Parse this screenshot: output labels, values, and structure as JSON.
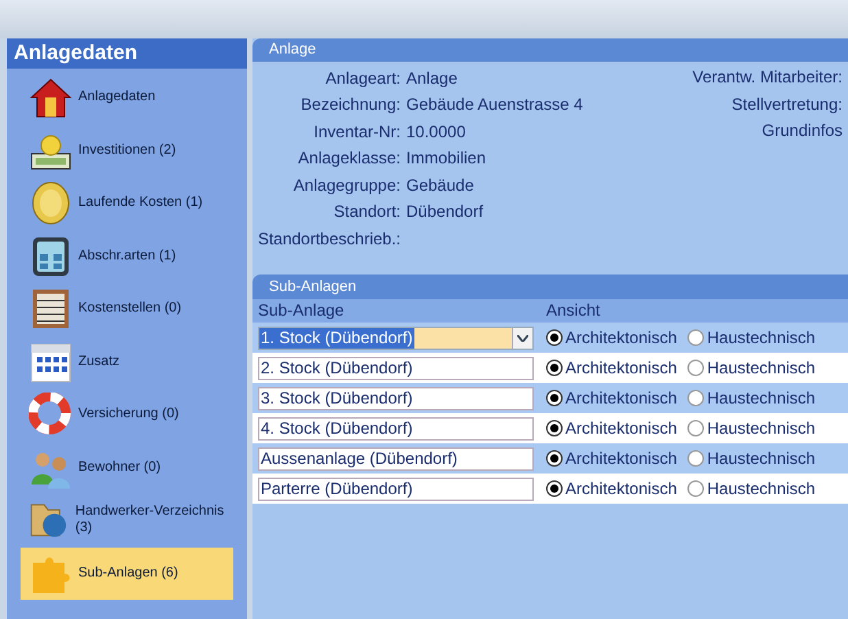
{
  "sidebar": {
    "title": "Anlagedaten",
    "items": [
      {
        "label": "Anlagedaten",
        "selected": false
      },
      {
        "label": "Investitionen (2)",
        "selected": false
      },
      {
        "label": "Laufende Kosten (1)",
        "selected": false
      },
      {
        "label": "Abschr.arten (1)",
        "selected": false
      },
      {
        "label": "Kostenstellen (0)",
        "selected": false
      },
      {
        "label": "Zusatz",
        "selected": false
      },
      {
        "label": "Versicherung (0)",
        "selected": false
      },
      {
        "label": "Bewohner (0)",
        "selected": false
      },
      {
        "label": "Handwerker-Verzeichnis (3)",
        "selected": false
      },
      {
        "label": "Sub-Anlagen (6)",
        "selected": true
      }
    ]
  },
  "anlage": {
    "title": "Anlage",
    "fields": [
      {
        "label": "Anlageart:",
        "value": "Anlage"
      },
      {
        "label": "Bezeichnung:",
        "value": "Gebäude Auenstrasse 4"
      },
      {
        "label": "Inventar-Nr:",
        "value": "10.0000"
      },
      {
        "label": "Anlageklasse:",
        "value": "Immobilien"
      },
      {
        "label": "Anlagegruppe:",
        "value": "Gebäude"
      },
      {
        "label": "Standort:",
        "value": "Dübendorf"
      },
      {
        "label": "Standortbeschrieb.:"
      }
    ],
    "right_labels": [
      "Verantw. Mitarbeiter:",
      "Stellvertretung:",
      "Grundinfos"
    ]
  },
  "sub_anlagen": {
    "title": "Sub-Anlagen",
    "columns": [
      "Sub-Anlage",
      "Ansicht"
    ],
    "rows": [
      {
        "kind": "combo",
        "value": "1. Stock (Dübendorf)",
        "options": [
          {
            "label": "Architektonisch",
            "selected": true
          },
          {
            "label": "Haustechnisch",
            "selected": false
          }
        ]
      },
      {
        "kind": "text",
        "value": "2. Stock (Dübendorf)",
        "options": [
          {
            "label": "Architektonisch",
            "selected": true
          },
          {
            "label": "Haustechnisch",
            "selected": false
          }
        ]
      },
      {
        "kind": "text",
        "value": "3. Stock (Dübendorf)",
        "options": [
          {
            "label": "Architektonisch",
            "selected": true
          },
          {
            "label": "Haustechnisch",
            "selected": false
          }
        ]
      },
      {
        "kind": "text",
        "value": "4. Stock (Dübendorf)",
        "options": [
          {
            "label": "Architektonisch",
            "selected": true
          },
          {
            "label": "Haustechnisch",
            "selected": false
          }
        ]
      },
      {
        "kind": "text",
        "value": "Aussenanlage (Dübendorf)",
        "options": [
          {
            "label": "Architektonisch",
            "selected": true
          },
          {
            "label": "Haustechnisch",
            "selected": false
          }
        ]
      },
      {
        "kind": "text",
        "value": "Parterre (Dübendorf)",
        "options": [
          {
            "label": "Architektonisch",
            "selected": true
          },
          {
            "label": "Haustechnisch",
            "selected": false
          }
        ]
      }
    ]
  }
}
